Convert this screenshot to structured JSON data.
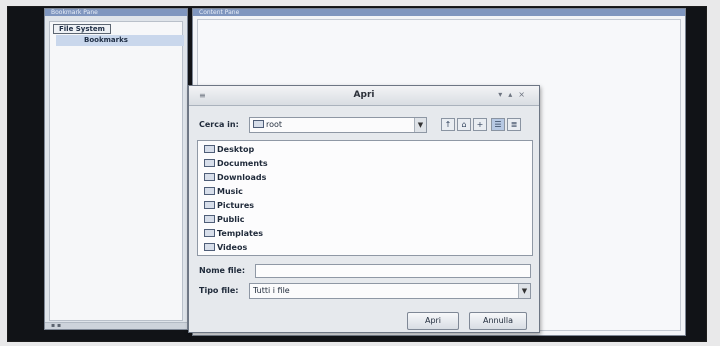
{
  "bookmarks_window": {
    "title": "Bookmark Pane",
    "tree_root": "File System",
    "tree_child": "Bookmarks"
  },
  "main_window": {
    "title": "Content Pane"
  },
  "dialog": {
    "title": "Apri",
    "look_in_label": "Cerca in:",
    "look_in_value": "root",
    "folders": [
      "Desktop",
      "Documents",
      "Downloads",
      "Music",
      "Pictures",
      "Public",
      "Templates",
      "Videos"
    ],
    "file_name_label": "Nome file:",
    "file_name_value": "",
    "file_type_label": "Tipo file:",
    "file_type_value": "Tutti i file",
    "open_button": "Apri",
    "cancel_button": "Annulla"
  },
  "icons": [
    "folder-icon",
    "up-folder-icon",
    "home-icon",
    "new-folder-icon",
    "list-view-icon",
    "details-view-icon",
    "chevron-down-icon"
  ]
}
